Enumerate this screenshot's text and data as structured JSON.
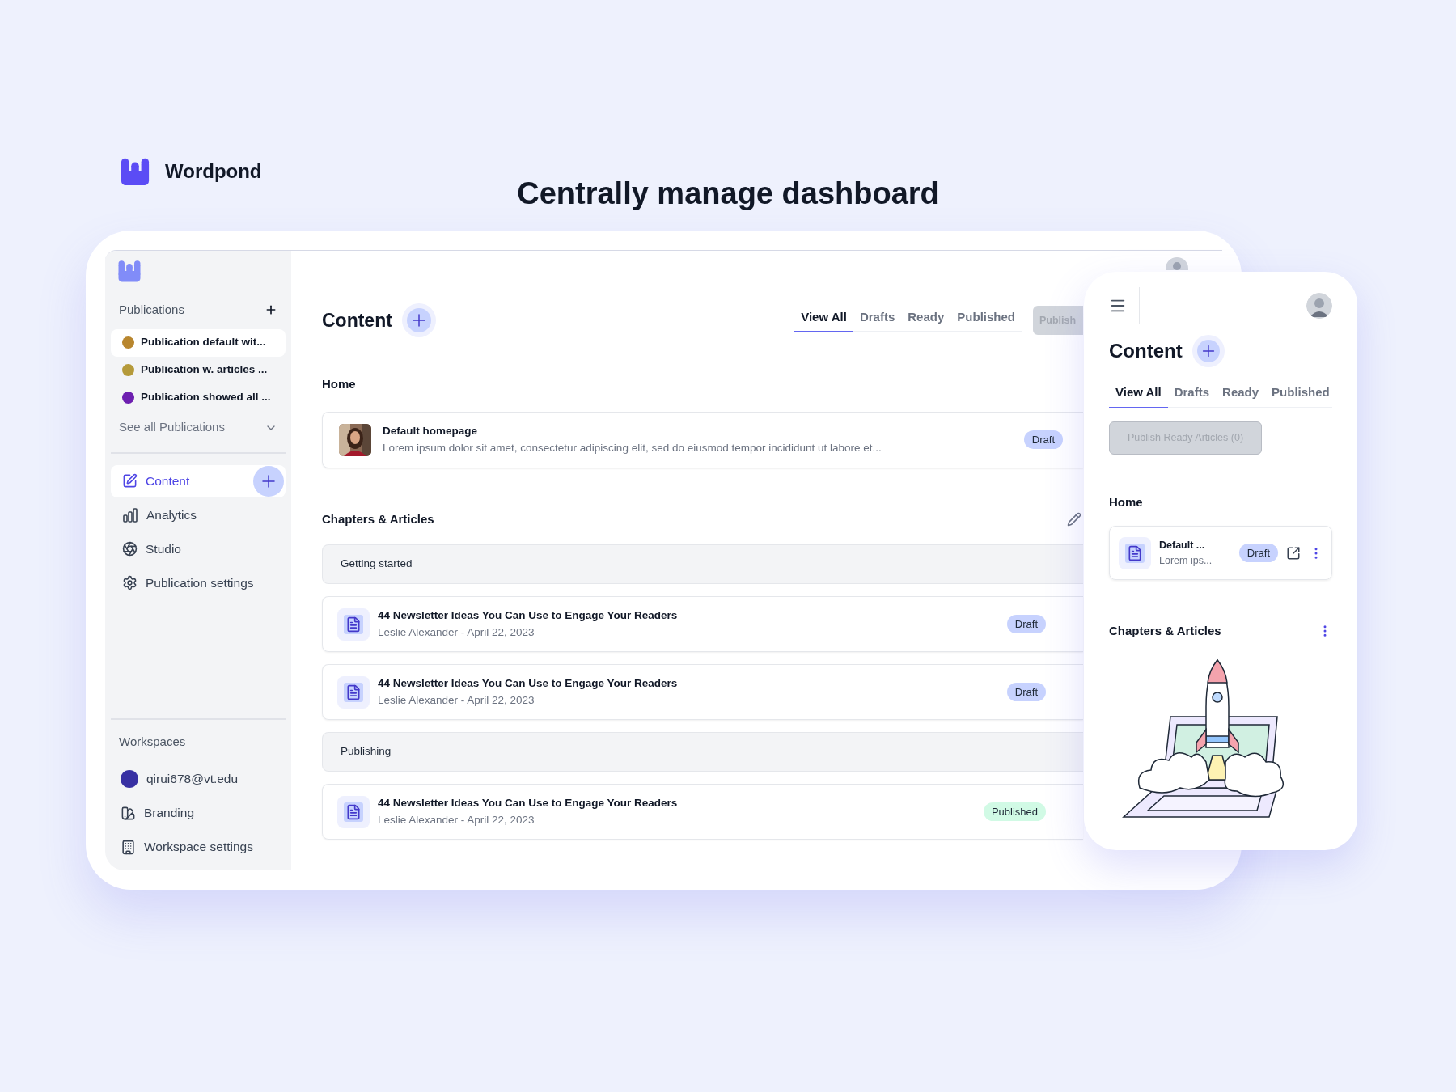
{
  "brand": {
    "name": "Wordpond"
  },
  "headline": "Centrally manage dashboard",
  "desktop": {
    "sidebar": {
      "publications_label": "Publications",
      "publications": [
        {
          "name": "Publication default wit...",
          "color": "#b8862e",
          "selected": true
        },
        {
          "name": "Publication w. articles ...",
          "color": "#b59a3a",
          "selected": false
        },
        {
          "name": "Publication showed all ...",
          "color": "#6d1fb0",
          "selected": false
        }
      ],
      "see_all": "See all Publications",
      "nav": [
        {
          "label": "Content",
          "kind": "edit",
          "selected": true
        },
        {
          "label": "Analytics",
          "kind": "chart",
          "selected": false
        },
        {
          "label": "Studio",
          "kind": "aperture",
          "selected": false
        },
        {
          "label": "Publication settings",
          "kind": "gear",
          "selected": false
        }
      ],
      "workspaces_label": "Workspaces",
      "workspace_items": [
        {
          "label": "qirui678@vt.edu",
          "kind": "account"
        },
        {
          "label": "Branding",
          "kind": "branding"
        },
        {
          "label": "Workspace settings",
          "kind": "building"
        }
      ]
    },
    "main": {
      "title": "Content",
      "tabs": [
        {
          "label": "View All",
          "selected": true
        },
        {
          "label": "Drafts",
          "selected": false
        },
        {
          "label": "Ready",
          "selected": false
        },
        {
          "label": "Published",
          "selected": false
        }
      ],
      "publish_button": {
        "label": "Publish",
        "disabled": true
      },
      "home_heading": "Home",
      "home_page": {
        "title": "Default homepage",
        "excerpt": "Lorem ipsum dolor sit amet, consectetur adipiscing elit, sed do eiusmod tempor incididunt ut labore et...",
        "status": "Draft",
        "published": false
      },
      "chapters_heading": "Chapters & Articles",
      "chapters": [
        {
          "name": "Getting started",
          "articles": [
            {
              "title": "44 Newsletter Ideas You Can Use to Engage Your Readers",
              "byline": "Leslie Alexander - April 22, 2023",
              "status": "Draft",
              "published": false
            },
            {
              "title": "44 Newsletter Ideas You Can Use to Engage Your Readers",
              "byline": "Leslie Alexander - April 22, 2023",
              "status": "Draft",
              "published": false
            }
          ]
        },
        {
          "name": "Publishing",
          "articles": [
            {
              "title": "44 Newsletter Ideas You Can Use to Engage Your Readers",
              "byline": "Leslie Alexander - April 22, 2023",
              "status": "Published",
              "published": true
            }
          ]
        }
      ]
    }
  },
  "mobile": {
    "title": "Content",
    "tabs": [
      {
        "label": "View All",
        "selected": true
      },
      {
        "label": "Drafts",
        "selected": false
      },
      {
        "label": "Ready",
        "selected": false
      },
      {
        "label": "Published",
        "selected": false
      }
    ],
    "publish_button": {
      "label": "Publish Ready Articles (0)",
      "disabled": true
    },
    "home_heading": "Home",
    "home_page": {
      "title": "Default ...",
      "excerpt": "Lorem ips...",
      "status": "Draft",
      "published": false
    },
    "chapters_heading": "Chapters & Articles"
  }
}
